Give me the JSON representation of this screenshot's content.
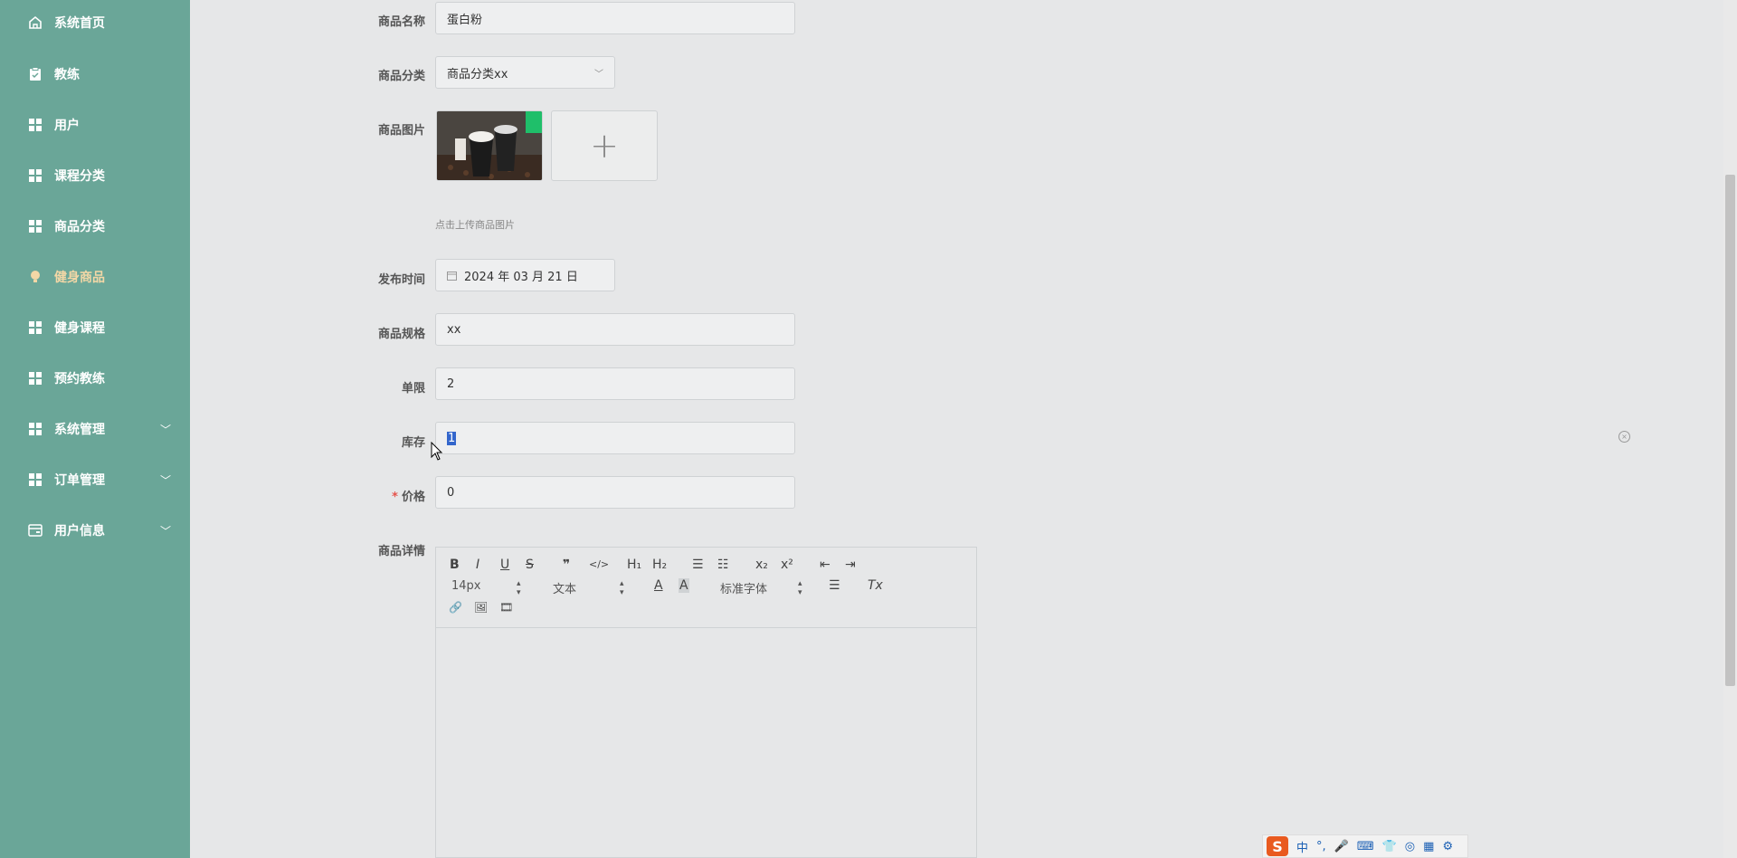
{
  "sidebar": {
    "items": [
      {
        "label": "系统首页",
        "icon": "home-icon"
      },
      {
        "label": "教练",
        "icon": "clipboard-icon"
      },
      {
        "label": "用户",
        "icon": "grid-icon"
      },
      {
        "label": "课程分类",
        "icon": "grid-icon"
      },
      {
        "label": "商品分类",
        "icon": "grid-icon"
      },
      {
        "label": "健身商品",
        "icon": "bulb-icon",
        "active": true
      },
      {
        "label": "健身课程",
        "icon": "grid-icon"
      },
      {
        "label": "预约教练",
        "icon": "grid-icon"
      },
      {
        "label": "系统管理",
        "icon": "grid-icon",
        "expandable": true
      },
      {
        "label": "订单管理",
        "icon": "grid-icon",
        "expandable": true
      },
      {
        "label": "用户信息",
        "icon": "card-icon",
        "expandable": true
      }
    ],
    "chevron": "﹀"
  },
  "form": {
    "name": {
      "label": "商品名称",
      "value": "蛋白粉"
    },
    "category": {
      "label": "商品分类",
      "value": "商品分类xx"
    },
    "image": {
      "label": "商品图片",
      "hint": "点击上传商品图片",
      "add": "+"
    },
    "publish_time": {
      "label": "发布时间",
      "value": "2024 年 03 月 21 日"
    },
    "spec": {
      "label": "商品规格",
      "value": "xx"
    },
    "limit": {
      "label": "单限",
      "value": "2"
    },
    "stock": {
      "label": "库存",
      "value": "1"
    },
    "price": {
      "label": "价格",
      "required_mark": "*",
      "value": "0"
    },
    "detail": {
      "label": "商品详情"
    }
  },
  "editor": {
    "size_select": "14px",
    "header_select": "文本",
    "font_select": "标准字体",
    "buttons": {
      "bold": "B",
      "italic": "I",
      "underline": "U",
      "strike": "S",
      "quote": "❞",
      "code": "</>",
      "h1": "H₁",
      "h2": "H₂",
      "ordered_list": "☰",
      "bullet_list": "☷",
      "sub": "x₂",
      "sup": "x²",
      "outdent": "⇤",
      "indent": "⇥",
      "color": "A",
      "background": "A",
      "align": "☰",
      "clean": "Tx",
      "link": "🔗",
      "image": "🖼",
      "video": "🎞"
    }
  },
  "ime": {
    "logo": "S",
    "mode": "中",
    "punct": "°,"
  }
}
